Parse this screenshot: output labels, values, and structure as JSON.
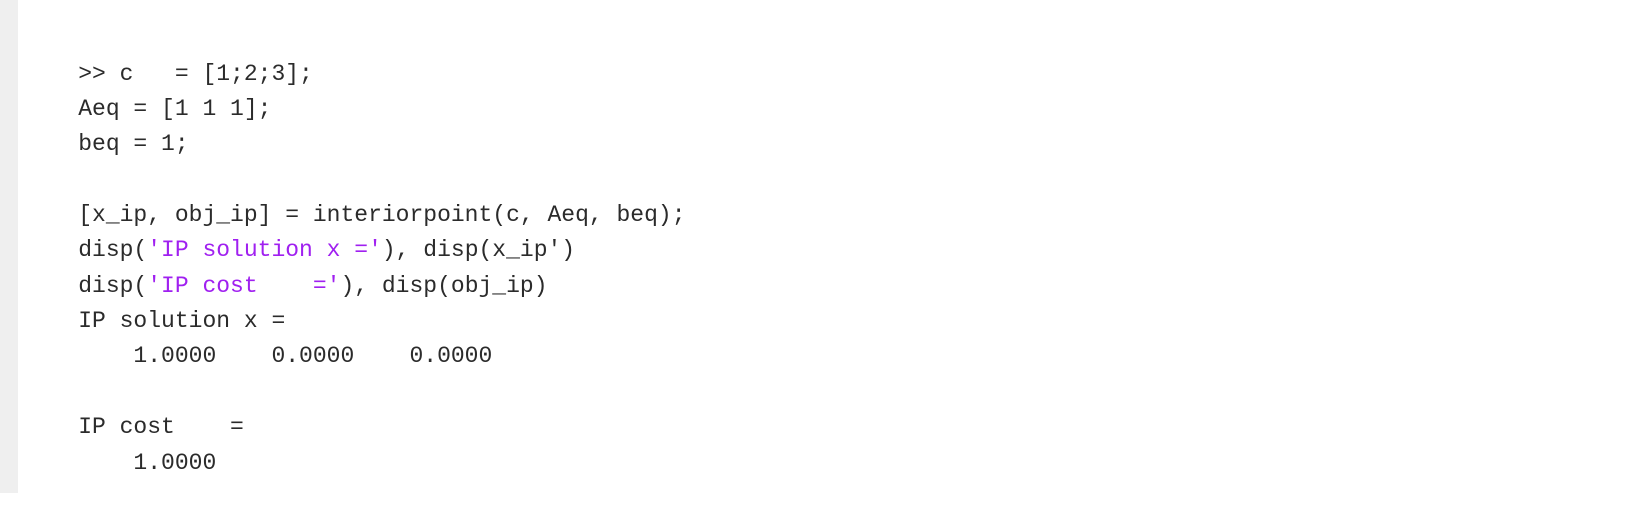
{
  "console": {
    "lines": [
      {
        "parts": [
          {
            "text": ">> c   = [1;2;3];"
          }
        ]
      },
      {
        "parts": [
          {
            "text": "Aeq = [1 1 1];"
          }
        ]
      },
      {
        "parts": [
          {
            "text": "beq = 1;"
          }
        ]
      },
      {
        "parts": [
          {
            "text": ""
          }
        ]
      },
      {
        "parts": [
          {
            "text": "[x_ip, obj_ip] = interiorpoint(c, Aeq, beq);"
          }
        ]
      },
      {
        "parts": [
          {
            "text": "disp("
          },
          {
            "text": "'IP solution x ='",
            "string": true
          },
          {
            "text": "), disp(x_ip')"
          }
        ]
      },
      {
        "parts": [
          {
            "text": "disp("
          },
          {
            "text": "'IP cost    ='",
            "string": true
          },
          {
            "text": "), disp(obj_ip)"
          }
        ]
      },
      {
        "parts": [
          {
            "text": "IP solution x ="
          }
        ]
      },
      {
        "parts": [
          {
            "text": "    1.0000    0.0000    0.0000"
          }
        ]
      },
      {
        "parts": [
          {
            "text": ""
          }
        ]
      },
      {
        "parts": [
          {
            "text": "IP cost    ="
          }
        ]
      },
      {
        "parts": [
          {
            "text": "    1.0000"
          }
        ]
      }
    ]
  },
  "colors": {
    "text": "#2b2b2b",
    "string": "#a020f0",
    "gutter": "#efefef",
    "background": "#ffffff"
  }
}
